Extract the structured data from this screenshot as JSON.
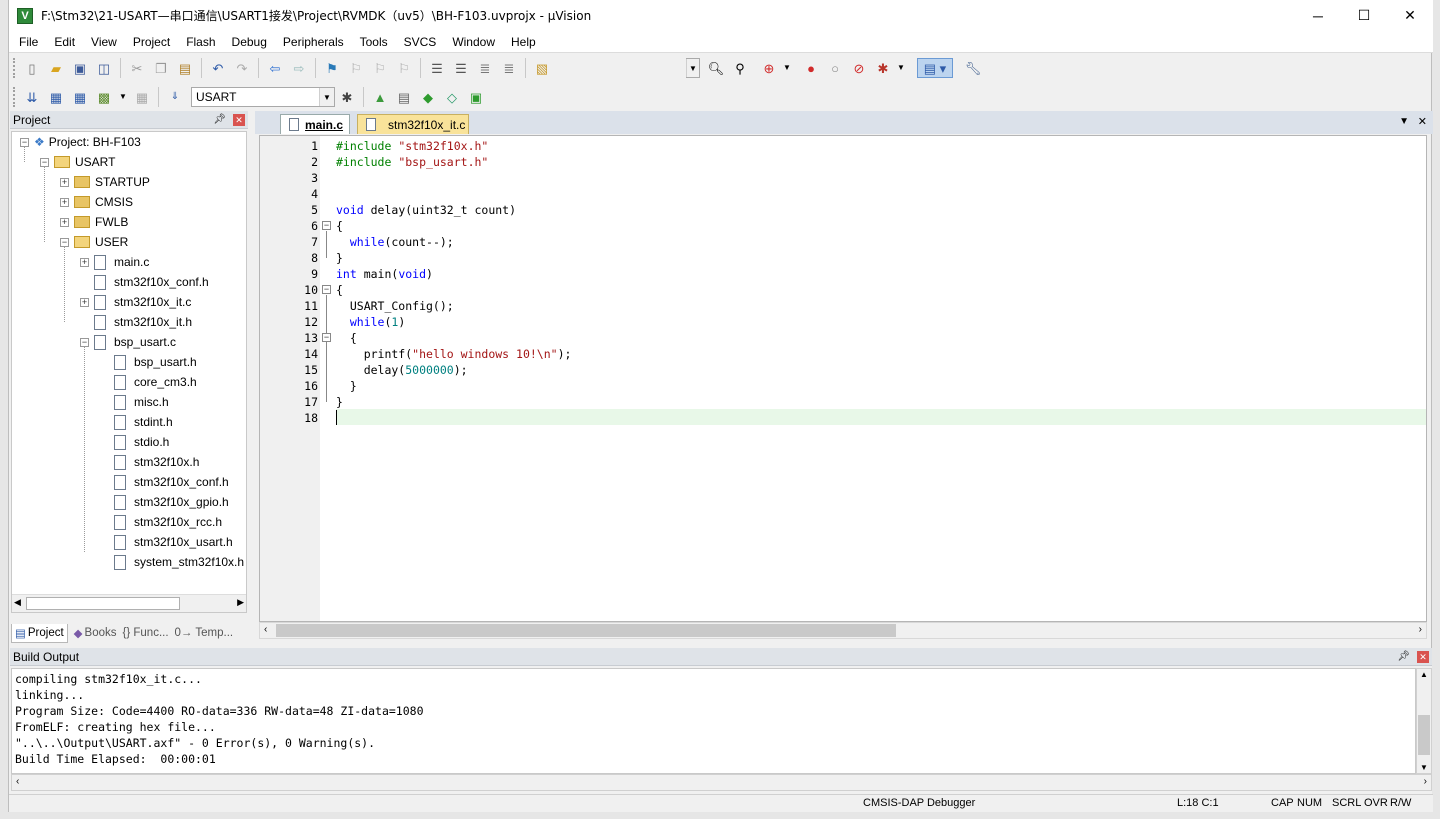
{
  "window": {
    "title": "F:\\Stm32\\21-USART—串口通信\\USART1接发\\Project\\RVMDK（uv5）\\BH-F103.uvprojx - µVision",
    "app_icon_letter": "V",
    "minimize": "─",
    "maximize": "☐",
    "close": "✕"
  },
  "menu": [
    "File",
    "Edit",
    "View",
    "Project",
    "Flash",
    "Debug",
    "Peripherals",
    "Tools",
    "SVCS",
    "Window",
    "Help"
  ],
  "toolbar2": {
    "target": "USART"
  },
  "project_pane": {
    "header": "Project",
    "pin": "ᵖ",
    "close": "✕",
    "root": "Project: BH-F103",
    "target": "USART",
    "groups": [
      "STARTUP",
      "CMSIS",
      "FWLB",
      "USER"
    ],
    "user_files": [
      "main.c",
      "stm32f10x_conf.h",
      "stm32f10x_it.c",
      "stm32f10x_it.h",
      "bsp_usart.c"
    ],
    "bsp_children": [
      "bsp_usart.h",
      "core_cm3.h",
      "misc.h",
      "stdint.h",
      "stdio.h",
      "stm32f10x.h",
      "stm32f10x_conf.h",
      "stm32f10x_gpio.h",
      "stm32f10x_rcc.h",
      "stm32f10x_usart.h",
      "system_stm32f10x.h"
    ],
    "tabs": [
      "Project",
      "Books",
      "{} Func...",
      "0→ Temp..."
    ]
  },
  "editor": {
    "tabs": [
      "main.c",
      "stm32f10x_it.c"
    ],
    "lines": [
      "#include \"stm32f10x.h\"",
      "#include \"bsp_usart.h\"",
      "",
      "",
      "void delay(uint32_t count)",
      "{",
      "  while(count--);",
      "}",
      "int main(void)",
      "{",
      "  USART_Config();",
      "  while(1)",
      "  {",
      "    printf(\"hello windows 10!\\n\");",
      "    delay(5000000);",
      "  }",
      "}",
      ""
    ]
  },
  "build_output": {
    "header": "Build Output",
    "lines": [
      "compiling stm32f10x_it.c...",
      "linking...",
      "Program Size: Code=4400 RO-data=336 RW-data=48 ZI-data=1080",
      "FromELF: creating hex file...",
      "\"..\\..\\Output\\USART.axf\" - 0 Error(s), 0 Warning(s).",
      "Build Time Elapsed:  00:00:01"
    ]
  },
  "status": {
    "debugger": "CMSIS-DAP Debugger",
    "position": "L:18 C:1",
    "cap": "CAP",
    "num": "NUM",
    "scrl": "SCRL",
    "ovr": "OVR",
    "rw": "R/W"
  }
}
